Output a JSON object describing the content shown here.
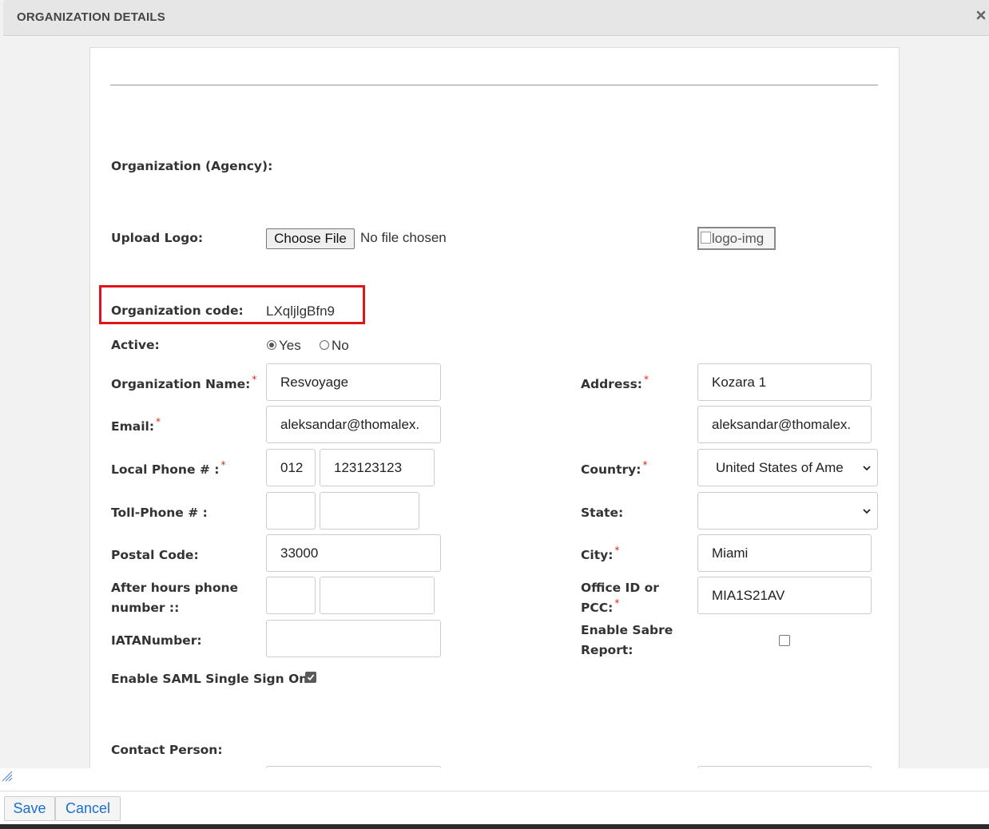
{
  "dialog": {
    "title": "ORGANIZATION DETAILS",
    "close_icon": "close-icon"
  },
  "form": {
    "section_org": "Organization (Agency):",
    "upload_logo_label": "Upload Logo:",
    "choose_file_label": "Choose File",
    "file_status": "No file chosen",
    "logo_alt": "logo-img",
    "org_code_label": "Organization code:",
    "org_code_value": "LXqljlgBfn9",
    "active_label": "Active:",
    "active_yes": "Yes",
    "active_no": "No",
    "active_selected": "Yes",
    "org_name_label": "Organization Name:",
    "org_name_value": "Resvoyage",
    "email_label": "Email:",
    "email_value": "aleksandar@thomalex.",
    "local_phone_label": "Local Phone # :",
    "local_phone_code": "012",
    "local_phone_number": "123123123",
    "toll_phone_label": "Toll-Phone # :",
    "toll_phone_code": "",
    "toll_phone_number": "",
    "postal_code_label": "Postal Code:",
    "postal_code_value": "33000",
    "after_hours_label_1": "After hours phone",
    "after_hours_label_2": "number ::",
    "after_hours_code": "",
    "after_hours_number": "",
    "iata_label": "IATANumber:",
    "iata_value": "",
    "saml_label": "Enable SAML Single Sign On:",
    "saml_checked": true,
    "address_label": "Address:",
    "address_line1": "Kozara 1",
    "address_line2": "aleksandar@thomalex.",
    "country_label": "Country:",
    "country_value": "United States of Ame",
    "state_label": "State:",
    "state_value": "",
    "city_label": "City:",
    "city_value": "Miami",
    "office_label_1": "Office ID or",
    "office_label_2": "PCC:",
    "office_value": "MIA1S21AV",
    "sabre_label_1": "Enable Sabre",
    "sabre_label_2": "Report:",
    "sabre_checked": false,
    "section_contact": "Contact Person:",
    "required_mark": "*"
  },
  "footer": {
    "save_label": "Save",
    "cancel_label": "Cancel"
  },
  "colors": {
    "required": "#e0241b",
    "highlight_box": "#e0141b",
    "button_text": "#1a6fd0"
  }
}
